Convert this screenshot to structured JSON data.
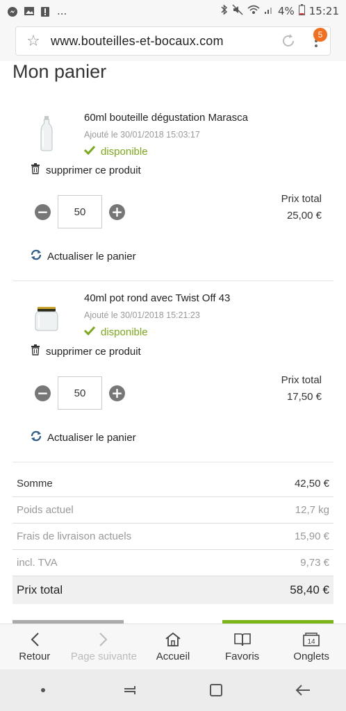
{
  "status_bar": {
    "left_more": "...",
    "battery": "4%",
    "time": "15:21"
  },
  "browser": {
    "url": "www.bouteilles-et-bocaux.com",
    "tabs_badge": "5"
  },
  "page": {
    "title": "Mon panier"
  },
  "cart": {
    "items": [
      {
        "name": "60ml bouteille dégustation Marasca",
        "added": "Ajouté le 30/01/2018 15:03:17",
        "availability": "disponible",
        "remove_label": "supprimer ce produit",
        "quantity": "50",
        "total_label": "Prix total",
        "total_value": "25,00 €",
        "refresh_label": "Actualiser le panier"
      },
      {
        "name": "40ml pot rond avec Twist Off 43",
        "added": "Ajouté le 30/01/2018 15:21:23",
        "availability": "disponible",
        "remove_label": "supprimer ce produit",
        "quantity": "50",
        "total_label": "Prix total",
        "total_value": "17,50 €",
        "refresh_label": "Actualiser le panier"
      }
    ]
  },
  "summary": {
    "sum_label": "Somme",
    "sum_value": "42,50 €",
    "weight_label": "Poids actuel",
    "weight_value": "12,7 kg",
    "shipping_label": "Frais de livraison actuels",
    "shipping_value": "15,90 €",
    "vat_label": "incl. TVA",
    "vat_value": "9,73 €",
    "grand_label": "Prix total",
    "grand_value": "58,40 €"
  },
  "bottom_nav": {
    "back": "Retour",
    "forward": "Page suivante",
    "home": "Accueil",
    "bookmarks": "Favoris",
    "tabs": "Onglets",
    "tabs_count": "14"
  },
  "colors": {
    "accent_green": "#7aaa1a",
    "badge_orange": "#f07020"
  }
}
